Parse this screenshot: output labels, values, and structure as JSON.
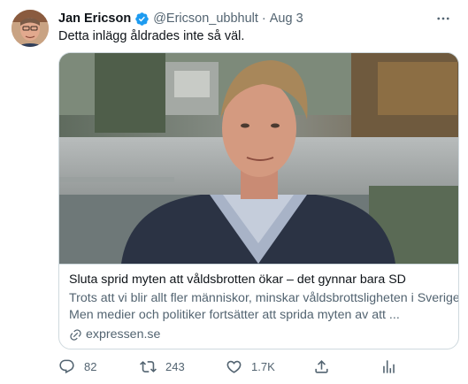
{
  "tweet": {
    "author_name": "Jan Ericson",
    "handle": "@Ericson_ubbhult",
    "separator": "·",
    "date": "Aug 3",
    "text": "Detta inlägg åldrades inte så väl."
  },
  "card": {
    "title": "Sluta sprid myten att våldsbrotten ökar – det gynnar bara SD",
    "description_line1": "Trots att vi blir allt fler människor, minskar våldsbrottsligheten i Sverige.",
    "description_line2": "Men medier och politiker fortsätter att sprida myten av att ...",
    "domain": "expressen.se"
  },
  "actions": {
    "replies": "82",
    "retweets": "243",
    "likes": "1.7K"
  },
  "colors": {
    "verified": "#1d9bf0",
    "secondary_text": "#536471",
    "border": "#cfd9de"
  },
  "icons": [
    "verified-badge-icon",
    "more-icon",
    "link-icon",
    "reply-icon",
    "retweet-icon",
    "like-icon",
    "share-icon",
    "analytics-icon"
  ]
}
